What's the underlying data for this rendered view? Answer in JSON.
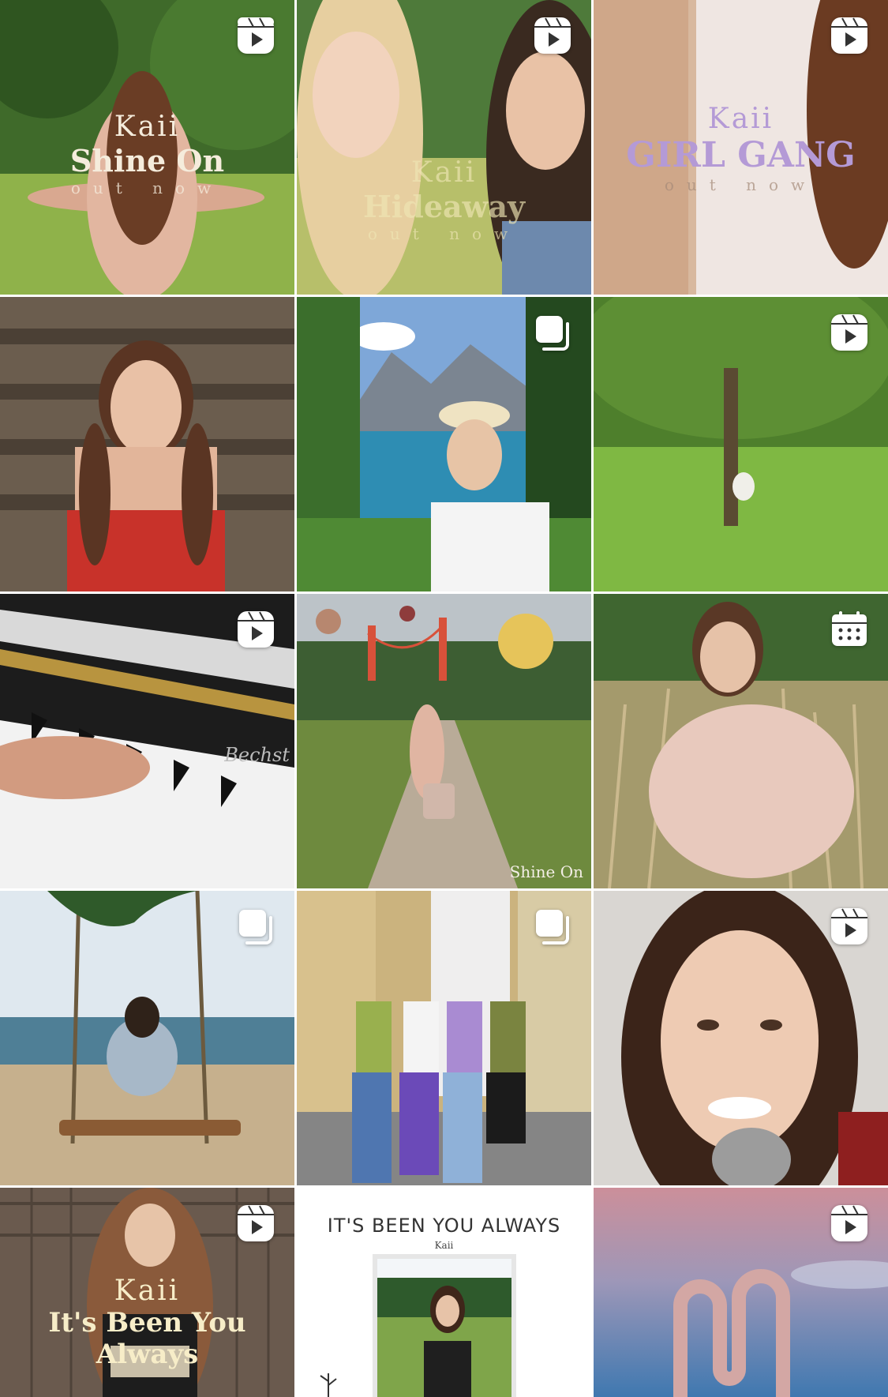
{
  "posts": [
    {
      "kind": "reel",
      "icon": "reel-icon",
      "overlay": {
        "artist": "Kaii",
        "title": "Shine On",
        "sub": "out now"
      }
    },
    {
      "kind": "reel",
      "icon": "reel-icon",
      "overlay": {
        "artist": "Kaii",
        "title": "Hideaway",
        "sub": "out now"
      }
    },
    {
      "kind": "reel",
      "icon": "reel-icon",
      "overlay": {
        "artist": "Kaii",
        "title": "GIRL GANG",
        "sub": "out now"
      }
    },
    {
      "kind": "image",
      "icon": ""
    },
    {
      "kind": "carousel",
      "icon": "carousel-icon"
    },
    {
      "kind": "reel",
      "icon": "reel-icon"
    },
    {
      "kind": "reel",
      "icon": "reel-icon",
      "watermark": "Bechst"
    },
    {
      "kind": "image",
      "icon": "",
      "caption": "Shine On"
    },
    {
      "kind": "scheduled",
      "icon": "calendar-icon"
    },
    {
      "kind": "carousel",
      "icon": "carousel-icon"
    },
    {
      "kind": "carousel",
      "icon": "carousel-icon"
    },
    {
      "kind": "reel",
      "icon": "reel-icon"
    },
    {
      "kind": "reel",
      "icon": "reel-icon",
      "overlay": {
        "artist": "Kaii",
        "title": "It's Been You Always"
      }
    },
    {
      "kind": "image",
      "icon": "",
      "poster": {
        "heading": "IT'S BEEN YOU ALWAYS",
        "artist": "Kaii"
      }
    },
    {
      "kind": "reel",
      "icon": "reel-icon"
    }
  ],
  "colors": {
    "grass": "#7fae3e",
    "sky": "#8fb3d9",
    "lake": "#2d8fb0",
    "piano": "#1a1a1a",
    "lavender": "#b39ddb"
  }
}
